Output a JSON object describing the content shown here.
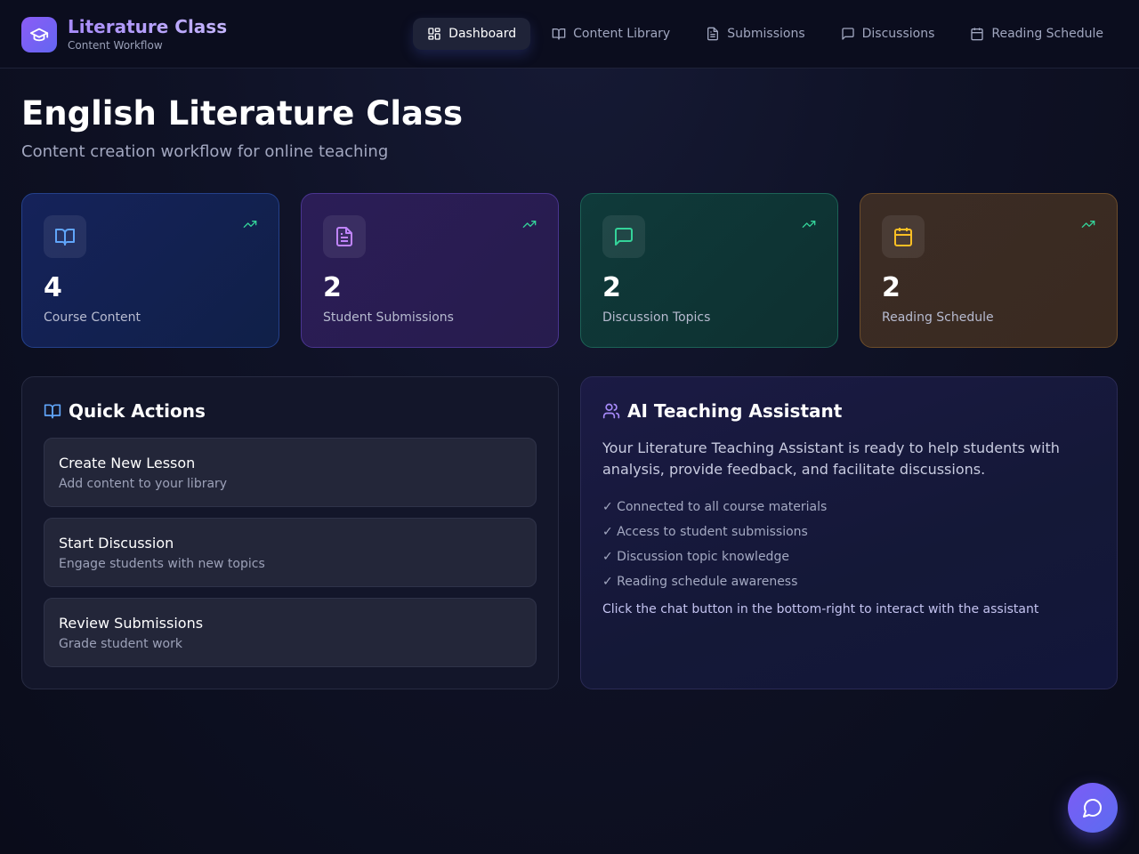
{
  "brand": {
    "title": "Literature Class",
    "subtitle": "Content Workflow",
    "icon": "graduation-cap-icon"
  },
  "nav": [
    {
      "label": "Dashboard",
      "icon": "dashboard-grid-icon",
      "active": true
    },
    {
      "label": "Content Library",
      "icon": "book-open-icon",
      "active": false
    },
    {
      "label": "Submissions",
      "icon": "file-text-icon",
      "active": false
    },
    {
      "label": "Discussions",
      "icon": "message-square-icon",
      "active": false
    },
    {
      "label": "Reading Schedule",
      "icon": "calendar-icon",
      "active": false
    }
  ],
  "page": {
    "title": "English Literature Class",
    "subtitle": "Content creation workflow for online teaching"
  },
  "stats": [
    {
      "value": "4",
      "label": "Course Content",
      "icon": "book-open-icon",
      "color": "#60a5fa"
    },
    {
      "value": "2",
      "label": "Student Submissions",
      "icon": "file-text-icon",
      "color": "#c084fc"
    },
    {
      "value": "2",
      "label": "Discussion Topics",
      "icon": "message-square-icon",
      "color": "#34d399"
    },
    {
      "value": "2",
      "label": "Reading Schedule",
      "icon": "calendar-icon",
      "color": "#fbbf24"
    }
  ],
  "quick_actions": {
    "title": "Quick Actions",
    "items": [
      {
        "title": "Create New Lesson",
        "desc": "Add content to your library"
      },
      {
        "title": "Start Discussion",
        "desc": "Engage students with new topics"
      },
      {
        "title": "Review Submissions",
        "desc": "Grade student work"
      }
    ]
  },
  "assistant": {
    "title": "AI Teaching Assistant",
    "description": "Your Literature Teaching Assistant is ready to help students with analysis, provide feedback, and facilitate discussions.",
    "features": [
      "✓ Connected to all course materials",
      "✓ Access to student submissions",
      "✓ Discussion topic knowledge",
      "✓ Reading schedule awareness"
    ],
    "note": "Click the chat button in the bottom-right to interact with the assistant"
  },
  "colors": {
    "accent": "#7c5cf6",
    "trend": "#34d399"
  }
}
